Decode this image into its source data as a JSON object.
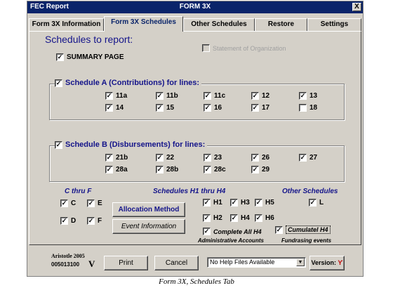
{
  "window": {
    "title_left": "FEC Report",
    "title_center": "FORM 3X",
    "close": "X"
  },
  "tabs": [
    {
      "label": "Form 3X Information"
    },
    {
      "label": "Form 3X Schedules"
    },
    {
      "label": "Other Schedules"
    },
    {
      "label": "Restore"
    },
    {
      "label": "Settings"
    }
  ],
  "schedules": {
    "heading": "Schedules to report:",
    "summary_page": {
      "label": "SUMMARY PAGE",
      "checked": "✓"
    },
    "statement_org": {
      "label": "Statement of Organization"
    },
    "schedule_a": {
      "label": "Schedule A (Contributions) for lines:",
      "checked": "✓",
      "lines": [
        {
          "label": "11a",
          "mark": "✓"
        },
        {
          "label": "11b",
          "mark": "✓"
        },
        {
          "label": "11c",
          "mark": "✓"
        },
        {
          "label": "12",
          "mark": "✓"
        },
        {
          "label": "13",
          "mark": "✓"
        },
        {
          "label": "14",
          "mark": "✓"
        },
        {
          "label": "15",
          "mark": "✓"
        },
        {
          "label": "16",
          "mark": "✓"
        },
        {
          "label": "17",
          "mark": "✓"
        },
        {
          "label": "18",
          "mark": ""
        }
      ]
    },
    "schedule_b": {
      "label": "Schedule B (Disbursements) for lines:",
      "checked": "✓",
      "lines": [
        {
          "label": "21b",
          "mark": "✓"
        },
        {
          "label": "22",
          "mark": "✓"
        },
        {
          "label": "23",
          "mark": "✓"
        },
        {
          "label": "26",
          "mark": "✓"
        },
        {
          "label": "27",
          "mark": "✓"
        },
        {
          "label": "28a",
          "mark": "✓"
        },
        {
          "label": "28b",
          "mark": "✓"
        },
        {
          "label": "28c",
          "mark": "✓"
        },
        {
          "label": "29",
          "mark": "✓"
        }
      ]
    },
    "c_thru_f": {
      "heading": "C thru F",
      "items": [
        {
          "label": "C",
          "mark": "✓"
        },
        {
          "label": "E",
          "mark": "✓"
        },
        {
          "label": "D",
          "mark": "✓"
        },
        {
          "label": "F",
          "mark": "✓"
        }
      ]
    },
    "h1_h4": {
      "heading": "Schedules H1 thru H4",
      "items": [
        {
          "label": "H1",
          "mark": "✓"
        },
        {
          "label": "H3",
          "mark": "✓"
        },
        {
          "label": "H5",
          "mark": "✓"
        },
        {
          "label": "H2",
          "mark": "✓"
        },
        {
          "label": "H4",
          "mark": "✓"
        },
        {
          "label": "H6",
          "mark": "✓"
        }
      ],
      "complete_h4": {
        "label": "Complete All H4",
        "mark": "✓"
      },
      "cumulative_h4": {
        "label": "Cumulatel H4",
        "mark": "✓"
      },
      "admin_accounts": "Administrative Accounts",
      "fundraising": "Fundrasing events"
    },
    "other": {
      "heading": "Other Schedules",
      "items": [
        {
          "label": "L",
          "mark": "✓"
        }
      ]
    },
    "allocation_button": "Allocation Method",
    "event_button": "Event Information"
  },
  "footer": {
    "brand_line1": "Aristotle 2005",
    "brand_line2": "005013100",
    "brand_mark": "V",
    "print": "Print",
    "cancel": "Cancel",
    "help_select": "No Help Files Available",
    "version": "Version:",
    "version_icon": "tulip-icon"
  },
  "caption": "Form 3X, Schedules Tab"
}
